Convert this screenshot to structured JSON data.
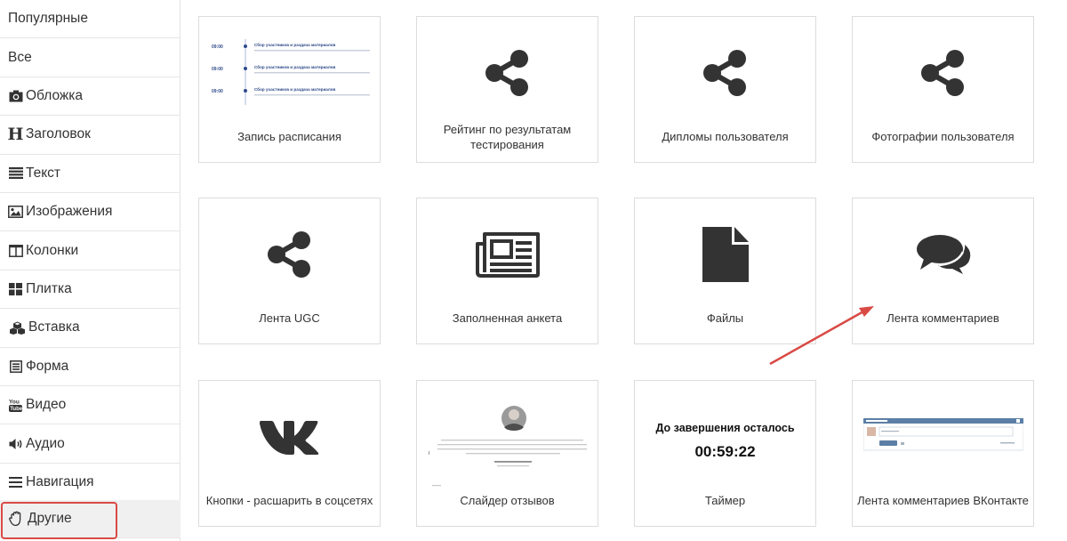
{
  "sidebar": {
    "items": [
      {
        "label": "Популярные",
        "icon": "none"
      },
      {
        "label": "Все",
        "icon": "none"
      },
      {
        "label": "Обложка",
        "icon": "camera-icon"
      },
      {
        "label": "Заголовок",
        "icon": "heading-icon"
      },
      {
        "label": "Текст",
        "icon": "text-lines-icon"
      },
      {
        "label": "Изображения",
        "icon": "image-icon"
      },
      {
        "label": "Колонки",
        "icon": "columns-icon"
      },
      {
        "label": "Плитка",
        "icon": "tiles-icon"
      },
      {
        "label": "Вставка",
        "icon": "cubes-icon"
      },
      {
        "label": "Форма",
        "icon": "form-icon"
      },
      {
        "label": "Видео",
        "icon": "youtube-icon"
      },
      {
        "label": "Аудио",
        "icon": "speaker-icon"
      },
      {
        "label": "Навигация",
        "icon": "menu-icon"
      },
      {
        "label": "Другие",
        "icon": "hand-icon",
        "active": true
      }
    ]
  },
  "cards": [
    {
      "label": "Запись расписания",
      "icon": "schedule-preview"
    },
    {
      "label": "Рейтинг по результатам тестирования",
      "icon": "share-icon"
    },
    {
      "label": "Дипломы пользователя",
      "icon": "share-icon"
    },
    {
      "label": "Фотографии пользователя",
      "icon": "share-icon"
    },
    {
      "label": "Лента UGC",
      "icon": "share-icon"
    },
    {
      "label": "Заполненная анкета",
      "icon": "newspaper-icon"
    },
    {
      "label": "Файлы",
      "icon": "file-icon"
    },
    {
      "label": "Лента комментариев",
      "icon": "comments-icon"
    },
    {
      "label": "Кнопки - расшарить в соцсетях",
      "icon": "vk-icon"
    },
    {
      "label": "Слайдер отзывов",
      "icon": "testimonial-preview"
    },
    {
      "label": "Таймер",
      "icon": "timer-preview"
    },
    {
      "label": "Лента комментариев ВКонтакте",
      "icon": "vk-comments-preview"
    }
  ],
  "schedule_preview": {
    "rows": [
      {
        "time": "09:00",
        "title": "Сбор участников и раздача материалов"
      },
      {
        "time": "09:00",
        "title": "Сбор участников и раздача материалов"
      },
      {
        "time": "09:00",
        "title": "Сбор участников и раздача материалов"
      }
    ]
  },
  "timer_preview": {
    "heading": "До завершения осталось",
    "time": "00:59:22"
  },
  "colors": {
    "accent_red": "#d94a45",
    "icon_dark": "#333333",
    "schedule_blue": "#2d4a8a"
  }
}
